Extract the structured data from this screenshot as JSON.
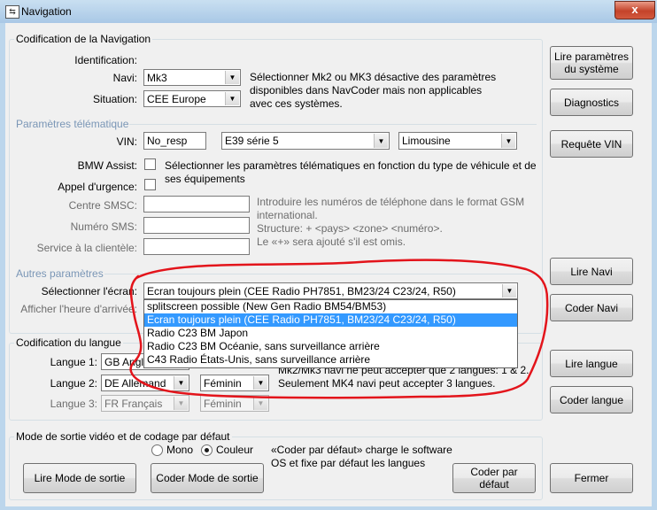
{
  "window": {
    "title": "Navigation",
    "title_icon": "app-window-icon",
    "close_symbol": "x"
  },
  "nav_group": {
    "title": "Codification de la Navigation",
    "identification_label": "Identification:",
    "navi_label": "Navi:",
    "navi_value": "Mk3",
    "situation_label": "Situation:",
    "situation_value": "CEE Europe",
    "navi_note": [
      "Sélectionner Mk2 ou MK3 désactive des paramètres",
      "disponibles dans NavCoder mais non applicables",
      "avec ces systèmes."
    ]
  },
  "telematic": {
    "title": "Paramètres télématique",
    "vin_label": "VIN:",
    "vin_value": "No_resp",
    "model_value": "E39 série 5",
    "body_value": "Limousine",
    "bmw_assist_label": "BMW Assist:",
    "emergency_label": "Appel d'urgence:",
    "note": [
      "Sélectionner les paramètres télématiques en fonction du type de véhicule et de",
      "ses équipements"
    ],
    "smsc_label": "Centre SMSC:",
    "sms_label": "Numéro SMS:",
    "service_label": "Service à la clientèle:",
    "phone_note": [
      "Introduire les numéros de téléphone dans le format GSM",
      "international.",
      "Structure: + <pays> <zone> <numéro>.",
      "Le «+» sera ajouté s'il est omis."
    ]
  },
  "other": {
    "title": "Autres paramètres",
    "screen_label": "Sélectionner l'écran:",
    "screen_value": "Ecran toujours plein (CEE Radio PH7851, BM23/24 C23/24, R50)",
    "time_label": "Afficher l'heure d'arrivée:",
    "options": [
      "splitscreen possible (New Gen Radio BM54/BM53)",
      "Ecran toujours plein (CEE Radio PH7851, BM23/24 C23/24, R50)",
      "Radio C23 BM Japon",
      "Radio C23 BM Océanie, sans surveillance arrière",
      "C43 Radio États-Unis, sans surveillance arrière"
    ],
    "selected_index": 1
  },
  "lang_group": {
    "title": "Codification du langue",
    "lang1_label": "Langue 1:",
    "lang1_value": "GB Anglais",
    "lang2_label": "Langue 2:",
    "lang2_value": "DE Allemand",
    "lang2_gender": "Féminin",
    "lang3_label": "Langue 3:",
    "lang3_value": "FR Français",
    "lang3_gender": "Féminin",
    "note": [
      "Mk2/Mk3 navi ne peut accepter que 2 langues: 1 & 2.",
      "Seulement MK4 navi peut accepter 3 langues."
    ]
  },
  "video_group": {
    "title": "Mode de sortie vidéo et de codage par défaut",
    "mono_label": "Mono",
    "couleur_label": "Couleur",
    "note": [
      "«Coder par défaut» charge le software",
      "OS et fixe par défaut les langues"
    ]
  },
  "buttons": {
    "read_system": [
      "Lire paramètres",
      "du système"
    ],
    "diagnostics": "Diagnostics",
    "request_vin": "Requête VIN",
    "read_navi": "Lire Navi",
    "code_navi": "Coder Navi",
    "read_lang": "Lire langue",
    "code_lang": "Coder langue",
    "read_mode": "Lire Mode de sortie",
    "code_mode": "Coder Mode de sortie",
    "code_default": [
      "Coder par",
      "défaut"
    ],
    "close": "Fermer"
  },
  "colors": {
    "annotation": "#e3141b",
    "selection": "#3399ff"
  },
  "icons": {
    "dropdown_arrow": "▼"
  }
}
